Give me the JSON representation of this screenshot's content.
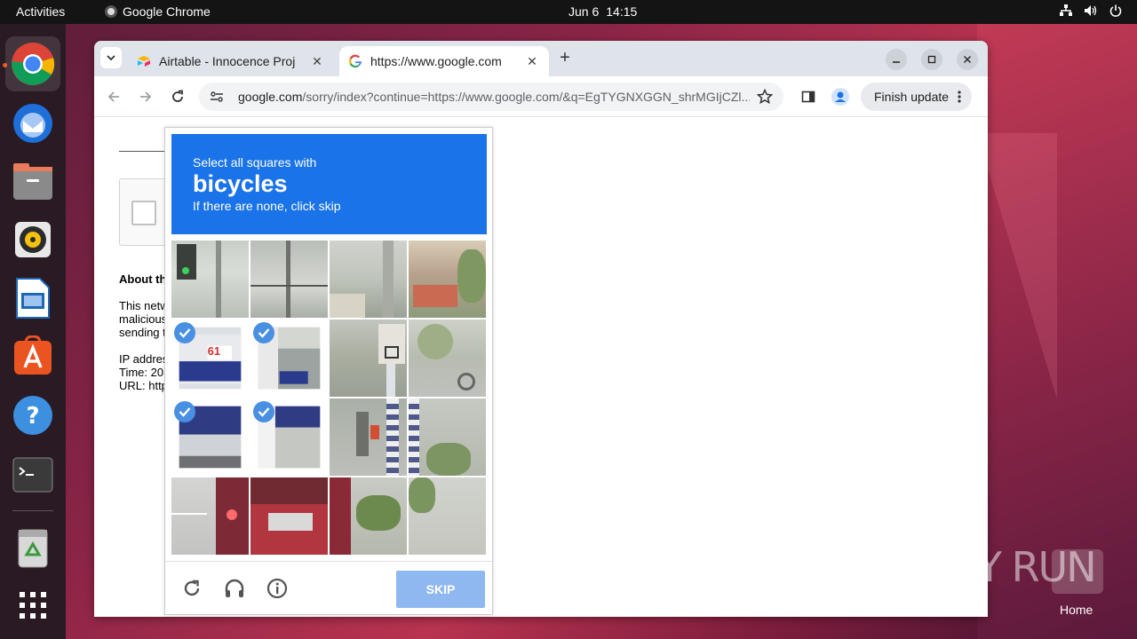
{
  "topbar": {
    "activities": "Activities",
    "app_name": "Google Chrome",
    "date": "Jun 6",
    "time": "14:15"
  },
  "dock": {
    "items": [
      "chrome",
      "thunderbird",
      "files",
      "rhythmbox",
      "libreoffice-impress",
      "app-center",
      "help",
      "terminal",
      "trash",
      "show-apps"
    ]
  },
  "browser": {
    "tabs": [
      {
        "title": "Airtable - Innocence Proj",
        "active": false
      },
      {
        "title": "https://www.google.com",
        "active": true
      }
    ],
    "url_host": "google.com",
    "url_path": "/sorry/index?continue=https://www.google.com/&q=EgTYGNXGGN_shrMGIjCZl...",
    "finish_update": "Finish update"
  },
  "page": {
    "about_heading": "About th",
    "body_lines": [
      "This netw",
      "malicious",
      "sending t"
    ],
    "ip_line": "IP addres",
    "time_line": "Time: 20",
    "url_line": "URL: http"
  },
  "captcha": {
    "instruction": "Select all squares with",
    "target": "bicycles",
    "hint": "If there are none, click skip",
    "skip_label": "SKIP",
    "selected_tiles": [
      4,
      5,
      8,
      9
    ]
  },
  "desktop": {
    "watermark": "ANY RUN",
    "home_label": "Home"
  },
  "colors": {
    "captcha_blue": "#1a73e8",
    "skip_disabled": "#8fb8f0",
    "check_blue": "#4a90e2"
  }
}
